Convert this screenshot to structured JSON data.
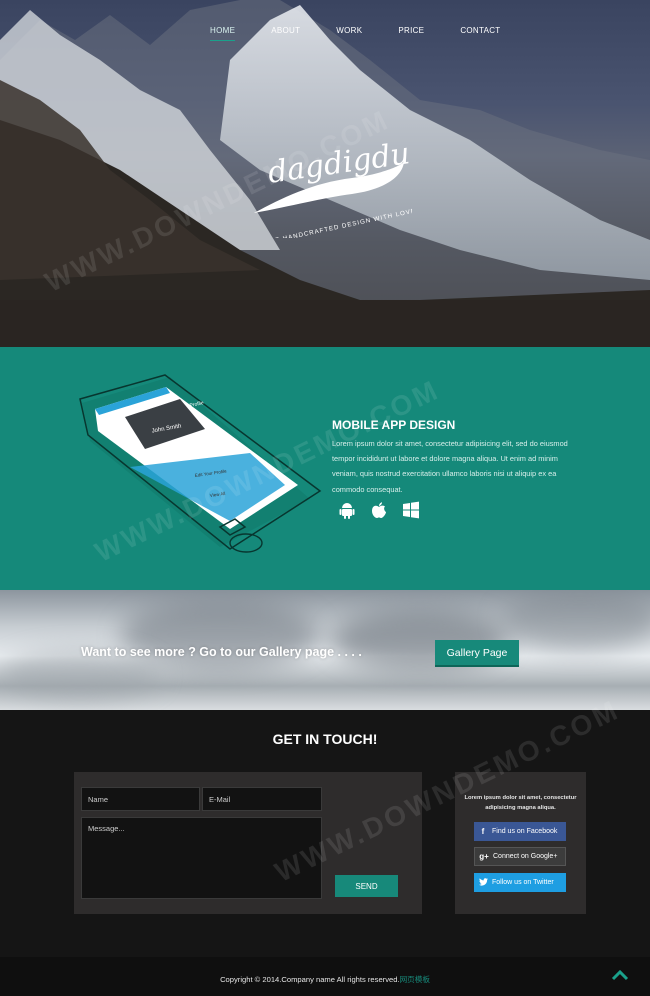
{
  "nav": {
    "items": [
      {
        "label": "HOME",
        "active": true
      },
      {
        "label": "ABOUT"
      },
      {
        "label": "WORK"
      },
      {
        "label": "PRICE"
      },
      {
        "label": "CONTACT"
      }
    ]
  },
  "hero": {
    "logo_text": "dagdigdug",
    "tagline": "WE HANDCRAFTED DESIGN WITH LOVE"
  },
  "app_section": {
    "title": "MOBILE APP DESIGN",
    "body": "Lorem ipsum dolor sit amet, consectetur adipisicing elit, sed do eiusmod tempor incididunt ut labore et dolore magna aliqua. Ut enim ad minim veniam, quis nostrud exercitation ullamco laboris nisi ut aliquip ex ea commodo consequat.",
    "icons": [
      "android-icon",
      "apple-icon",
      "windows-icon"
    ],
    "phone_screen": {
      "header": "Profile",
      "user": "John Smith",
      "action": "Edit Your Profile",
      "link": "View All"
    }
  },
  "gallery": {
    "text": "Want to see more ? Go to our Gallery page . . . .",
    "button": "Gallery Page"
  },
  "contact": {
    "title": "GET IN TOUCH!",
    "name_placeholder": "Name",
    "email_placeholder": "E-Mail",
    "message_placeholder": "Message...",
    "send": "SEND",
    "social_text": "Lorem ipsum dolor sit amet, consectetur adipisicing magna aliqua.",
    "facebook": "Find us on Facebook",
    "google": "Connect on Google+",
    "twitter": "Follow us on Twitter"
  },
  "footer": {
    "copyright": "Copyright © 2014.Company name All rights reserved.",
    "link": "网页模板"
  },
  "watermark": "WWW.DOWNDEMO.COM",
  "colors": {
    "accent": "#17897a",
    "facebook": "#3a5795",
    "twitter": "#1e9ee2"
  }
}
